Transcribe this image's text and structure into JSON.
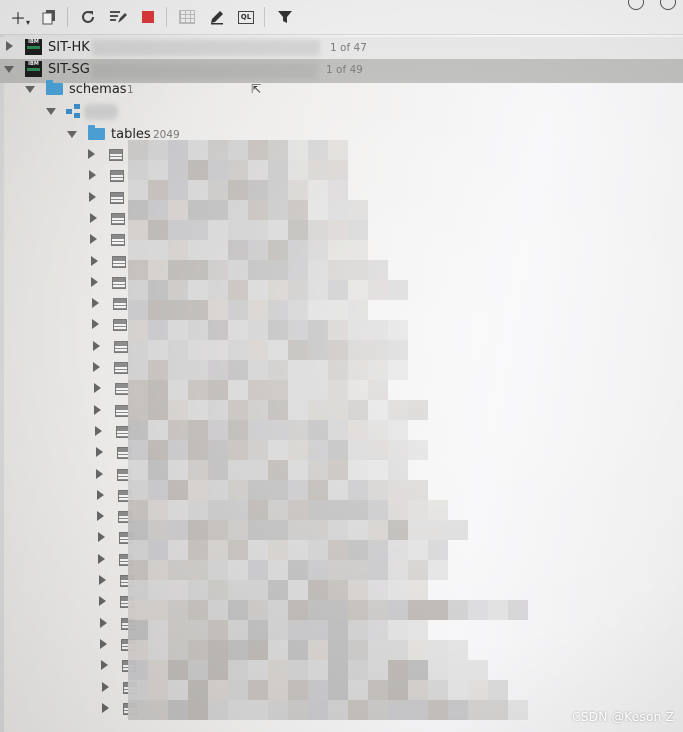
{
  "toolbar": {
    "icons": [
      "add-icon",
      "copy-icon",
      "refresh-icon",
      "edit-sql-icon",
      "stop-icon",
      "table-grid-icon",
      "pencil-icon",
      "ql-icon",
      "filter-icon"
    ],
    "ql_label": "QL",
    "stop_color": "#d93a3a"
  },
  "tree": {
    "connections": [
      {
        "name": "SIT-HK",
        "count": "1 of 47",
        "expanded": false
      },
      {
        "name": "SIT-SG",
        "count": "1 of 49",
        "expanded": true,
        "selected": true
      }
    ],
    "schemas": {
      "label": "schemas",
      "count": "1"
    },
    "tables": {
      "label": "tables",
      "count": "2049"
    }
  },
  "colors": {
    "folder": "#4ba1d6",
    "selected_row": "#bdbdbb",
    "schema_icon": "#3e8fc9"
  },
  "watermark": "CSDN @Keson Z"
}
